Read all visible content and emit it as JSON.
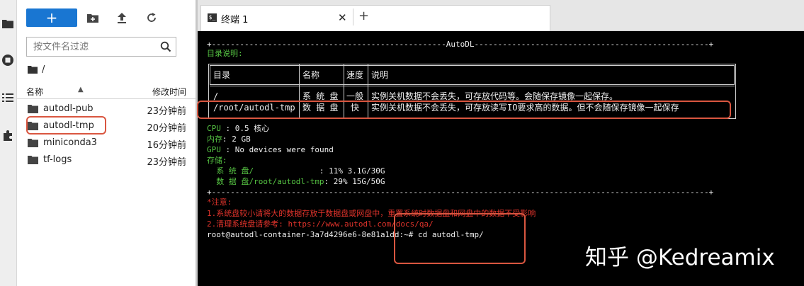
{
  "file_browser": {
    "new_button": "+",
    "filter_placeholder": "按文件名过滤",
    "breadcrumb": {
      "sep": "/"
    },
    "columns": {
      "name": "名称",
      "modified": "修改时间"
    },
    "rows": [
      {
        "name": "autodl-pub",
        "time": "23分钟前"
      },
      {
        "name": "autodl-tmp",
        "time": "20分钟前"
      },
      {
        "name": "miniconda3",
        "time": "16分钟前"
      },
      {
        "name": "tf-logs",
        "time": "23分钟前"
      }
    ]
  },
  "tabs": [
    {
      "label": "终端 1",
      "close": "✕"
    }
  ],
  "terminal": {
    "border_top": "+--------------------------------------------------AutoDL--------------------------------------------------+",
    "dir_heading": "目录说明:",
    "table": {
      "headers": [
        "目录",
        "名称",
        "速度",
        "说明"
      ],
      "rows": [
        [
          "/",
          "系 统 盘",
          "一般",
          "实例关机数据不会丢失，可存放代码等。会随保存镜像一起保存。"
        ],
        [
          "/root/autodl-tmp",
          "数 据 盘",
          "快",
          "实例关机数据不会丢失，可存放读写IO要求高的数据。但不会随保存镜像一起保存"
        ]
      ]
    },
    "cpu_label": "CPU",
    "cpu_value": " : 0.5 核心",
    "mem_label": "内存",
    "mem_value": ": 2 GB",
    "gpu_label": "GPU",
    "gpu_value": " : No devices were found",
    "storage_label": "存储:",
    "sys_disk_label": "  系 统 盘/",
    "sys_disk_value": "              : 11% 3.1G/30G",
    "data_disk_label": "  数 据 盘/root/autodl-tmp",
    "data_disk_value": ": 29% 15G/50G",
    "border_bottom": "+----------------------------------------------------------------------------------------------------------+",
    "notice_title": "*注意:",
    "notice_1": "1.系统盘较小请将大的数据存放于数据盘或网盘中，重置系统时数据盘和网盘中的数据不受影响",
    "notice_2": "2.清理系统盘请参考: https://www.autodl.com/docs/qa/",
    "prompt": "root@autodl-container-3a7d4296e6-8e81a1dd:~# cd autodl-tmp/"
  },
  "watermark": "知乎 @Kedreamix",
  "colors": {
    "accent_blue": "#1976d2",
    "terminal_green": "#56c443",
    "terminal_red": "#e0332b",
    "highlight_box": "#d95640"
  },
  "icons": {
    "rail": [
      "folder-icon",
      "running-icon",
      "commands-icon",
      "extension-icon"
    ],
    "toolbar": [
      "new-folder-icon",
      "upload-icon",
      "refresh-icon"
    ],
    "filter": "search-icon"
  }
}
